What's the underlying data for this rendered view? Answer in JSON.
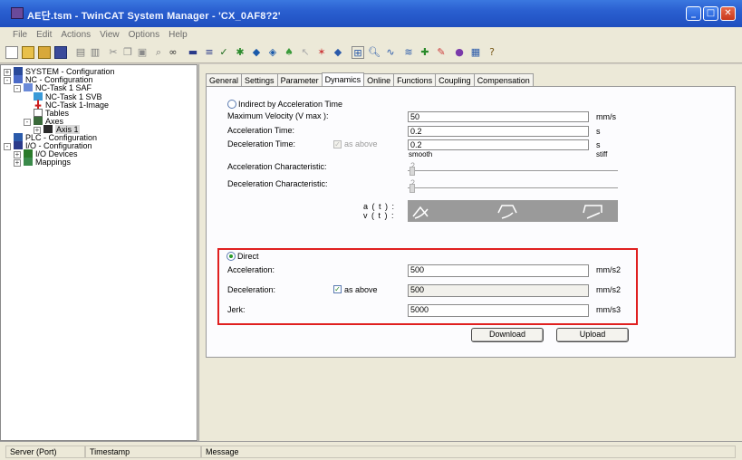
{
  "window": {
    "title": "AE단.tsm - TwinCAT System Manager - 'CX_0AF8?2'",
    "min_icon": "minimize-icon",
    "max_icon": "maximize-icon",
    "close_icon": "close-icon"
  },
  "menu": [
    "File",
    "Edit",
    "Actions",
    "View",
    "Options",
    "Help"
  ],
  "toolbar_icons": [
    "new-icon",
    "open-icon",
    "open-remote-icon",
    "save-icon",
    "print-icon",
    "print-preview-icon",
    "cut-icon",
    "copy-icon",
    "paste-icon",
    "find-icon",
    "binoculars-icon",
    "monitor-icon",
    "check-icon",
    "activate-icon",
    "restart-icon",
    "run-icon",
    "free-run-icon",
    "zoom-icon",
    "scope-icon",
    "target-icon",
    "network-icon",
    "cursor-icon",
    "settings-icon",
    "help-icon"
  ],
  "tree": [
    {
      "label": "SYSTEM - Configuration",
      "icon": "system-icon",
      "expander": "+"
    },
    {
      "label": "NC - Configuration",
      "icon": "nc-icon",
      "expander": "-"
    },
    {
      "label": "NC-Task 1 SAF",
      "icon": "task-icon",
      "expander": "-"
    },
    {
      "label": "NC-Task 1 SVB",
      "icon": "task-svb-icon",
      "expander": ""
    },
    {
      "label": "NC-Task 1-Image",
      "icon": "image-icon",
      "expander": ""
    },
    {
      "label": "Tables",
      "icon": "tables-icon",
      "expander": ""
    },
    {
      "label": "Axes",
      "icon": "axes-icon",
      "expander": "-"
    },
    {
      "label": "Axis 1",
      "icon": "axis-icon",
      "expander": "+"
    },
    {
      "label": "PLC - Configuration",
      "icon": "plc-icon",
      "expander": ""
    },
    {
      "label": "I/O - Configuration",
      "icon": "io-icon",
      "expander": "-"
    },
    {
      "label": "I/O Devices",
      "icon": "devices-icon",
      "expander": "+"
    },
    {
      "label": "Mappings",
      "icon": "mappings-icon",
      "expander": "+"
    }
  ],
  "tabs": [
    "General",
    "Settings",
    "Parameter",
    "Dynamics",
    "Online",
    "Functions",
    "Coupling",
    "Compensation"
  ],
  "active_tab": "Dynamics",
  "indirect": {
    "radio_label": "Indirect by Acceleration Time",
    "max_velocity_label": "Maximum Velocity (V max ):",
    "max_velocity_value": "50",
    "max_velocity_unit": "mm/s",
    "accel_time_label": "Acceleration Time:",
    "accel_time_value": "0.2",
    "accel_time_unit": "s",
    "decel_time_label": "Deceleration Time:",
    "decel_as_above_label": "as above",
    "decel_time_value": "0.2",
    "decel_time_unit": "s",
    "smooth_label": "smooth",
    "stiff_label": "stiff",
    "accel_char_label": "Acceleration Characteristic:",
    "accel_char_value": "2",
    "decel_char_label": "Deceleration Characteristic:",
    "decel_char_value": "2",
    "a_t_label": "a ( t ) :",
    "v_t_label": "v ( t ) :"
  },
  "direct": {
    "radio_label": "Direct",
    "accel_label": "Acceleration:",
    "accel_value": "500",
    "accel_unit": "mm/s2",
    "decel_label": "Deceleration:",
    "decel_as_above_label": "as above",
    "decel_value": "500",
    "decel_unit": "mm/s2",
    "jerk_label": "Jerk:",
    "jerk_value": "5000",
    "jerk_unit": "mm/s3"
  },
  "buttons": {
    "download": "Download",
    "upload": "Upload"
  },
  "status": {
    "server_port": "Server (Port)",
    "timestamp": "Timestamp",
    "message": "Message"
  },
  "colors": {
    "highlight": "#e02020",
    "titlebar": "#2a5fd0"
  }
}
